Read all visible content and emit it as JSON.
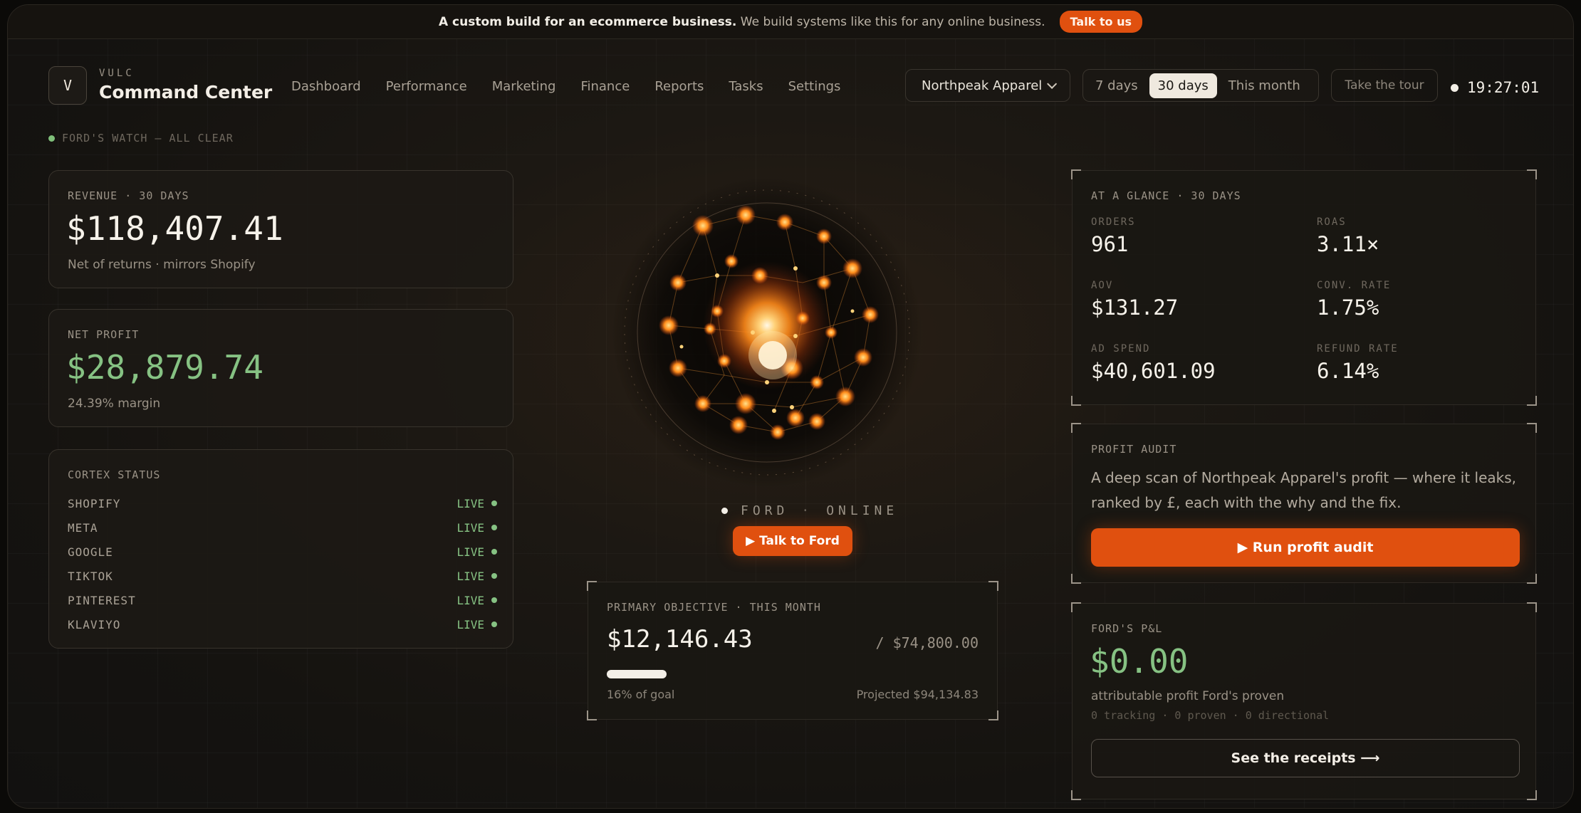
{
  "announcement": {
    "bold": "A custom build for an ecommerce business.",
    "rest": "We build systems like this for any online business.",
    "cta": "Talk to us"
  },
  "brand": {
    "logo_letter": "V",
    "sub": "VULC",
    "title": "Command Center"
  },
  "nav": [
    "Dashboard",
    "Performance",
    "Marketing",
    "Finance",
    "Reports",
    "Tasks",
    "Settings"
  ],
  "store_select": {
    "value": "Northpeak Apparel"
  },
  "range": {
    "options": [
      "7 days",
      "30 days",
      "This month"
    ],
    "active": "30 days"
  },
  "tour_label": "Take the tour",
  "clock": "19:27:01",
  "watch_status": "FORD'S WATCH — ALL CLEAR",
  "revenue": {
    "label": "REVENUE · 30 DAYS",
    "value": "$118,407.41",
    "note": "Net of returns · mirrors Shopify"
  },
  "net_profit": {
    "label": "NET PROFIT",
    "value": "$28,879.74",
    "note": "24.39% margin"
  },
  "cortex": {
    "label": "CORTEX STATUS",
    "items": [
      {
        "name": "SHOPIFY",
        "status": "LIVE"
      },
      {
        "name": "META",
        "status": "LIVE"
      },
      {
        "name": "GOOGLE",
        "status": "LIVE"
      },
      {
        "name": "TIKTOK",
        "status": "LIVE"
      },
      {
        "name": "PINTEREST",
        "status": "LIVE"
      },
      {
        "name": "KLAVIYO",
        "status": "LIVE"
      }
    ]
  },
  "orb": {
    "name": "FORD",
    "state": "ONLINE",
    "cta": "▶ Talk to Ford"
  },
  "objective": {
    "label": "PRIMARY OBJECTIVE · THIS MONTH",
    "value": "$12,146.43",
    "target": "/ $74,800.00",
    "progress": 0.16,
    "progress_label": "16% of goal",
    "projected": "Projected $94,134.83"
  },
  "glance": {
    "label": "AT A GLANCE · 30 DAYS",
    "orders_k": "ORDERS",
    "orders_v": "961",
    "roas_k": "ROAS",
    "roas_v": "3.11×",
    "aov_k": "AOV",
    "aov_v": "$131.27",
    "conv_k": "CONV. RATE",
    "conv_v": "1.75%",
    "spend_k": "AD SPEND",
    "spend_v": "$40,601.09",
    "refund_k": "REFUND RATE",
    "refund_v": "6.14%"
  },
  "audit": {
    "label": "PROFIT AUDIT",
    "text": "A deep scan of Northpeak Apparel's profit — where it leaks, ranked by £, each with the why and the fix.",
    "cta": "▶ Run profit audit"
  },
  "pnl": {
    "label": "FORD'S P&L",
    "value": "$0.00",
    "note": "attributable profit Ford's proven",
    "sub": "0 tracking · 0 proven · 0 directional",
    "cta": "See the receipts ⟶"
  },
  "colors": {
    "accent": "#e0500f",
    "positive": "#86c283",
    "warning": "#f0a84b"
  }
}
